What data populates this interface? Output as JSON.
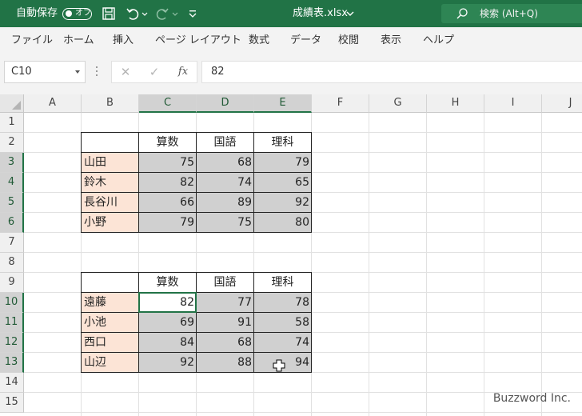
{
  "titlebar": {
    "autosave_label": "自動保存",
    "autosave_state": "オフ",
    "document_title": "成績表.xlsx",
    "search_label": "検索 (Alt+Q)"
  },
  "ribbon": {
    "tabs": [
      "ファイル",
      "ホーム",
      "挿入",
      "ページ レイアウト",
      "数式",
      "データ",
      "校閲",
      "表示",
      "ヘルプ"
    ]
  },
  "formula_bar": {
    "name_box": "C10",
    "cancel_icon": "✕",
    "enter_icon": "✓",
    "function_icon": "fx",
    "value": "82"
  },
  "grid": {
    "columns": [
      "A",
      "B",
      "C",
      "D",
      "E",
      "F",
      "G",
      "H",
      "I",
      "J"
    ],
    "rows": [
      "1",
      "2",
      "3",
      "4",
      "5",
      "6",
      "7",
      "8",
      "9",
      "10",
      "11",
      "12",
      "13",
      "14",
      "15"
    ],
    "selected_columns": [
      "C",
      "D",
      "E"
    ],
    "selected_rows": [
      "3",
      "4",
      "5",
      "6",
      "10",
      "11",
      "12",
      "13"
    ],
    "table1": {
      "headers": [
        "算数",
        "国語",
        "理科"
      ],
      "rows": [
        {
          "name": "山田",
          "values": [
            "75",
            "68",
            "79"
          ]
        },
        {
          "name": "鈴木",
          "values": [
            "82",
            "74",
            "65"
          ]
        },
        {
          "name": "長谷川",
          "values": [
            "66",
            "89",
            "92"
          ]
        },
        {
          "name": "小野",
          "values": [
            "79",
            "75",
            "80"
          ]
        }
      ]
    },
    "table2": {
      "headers": [
        "算数",
        "国語",
        "理科"
      ],
      "rows": [
        {
          "name": "遠藤",
          "values": [
            "82",
            "77",
            "78"
          ]
        },
        {
          "name": "小池",
          "values": [
            "69",
            "91",
            "58"
          ]
        },
        {
          "name": "西口",
          "values": [
            "84",
            "68",
            "74"
          ]
        },
        {
          "name": "山辺",
          "values": [
            "92",
            "88",
            "94"
          ]
        }
      ]
    },
    "active_cell": "C10"
  },
  "watermark": "Buzzword Inc.",
  "colors": {
    "title_bar": "#217346",
    "name_fill": "#fce4d6",
    "score_fill": "#d0d0d0",
    "selection": "#217346"
  }
}
